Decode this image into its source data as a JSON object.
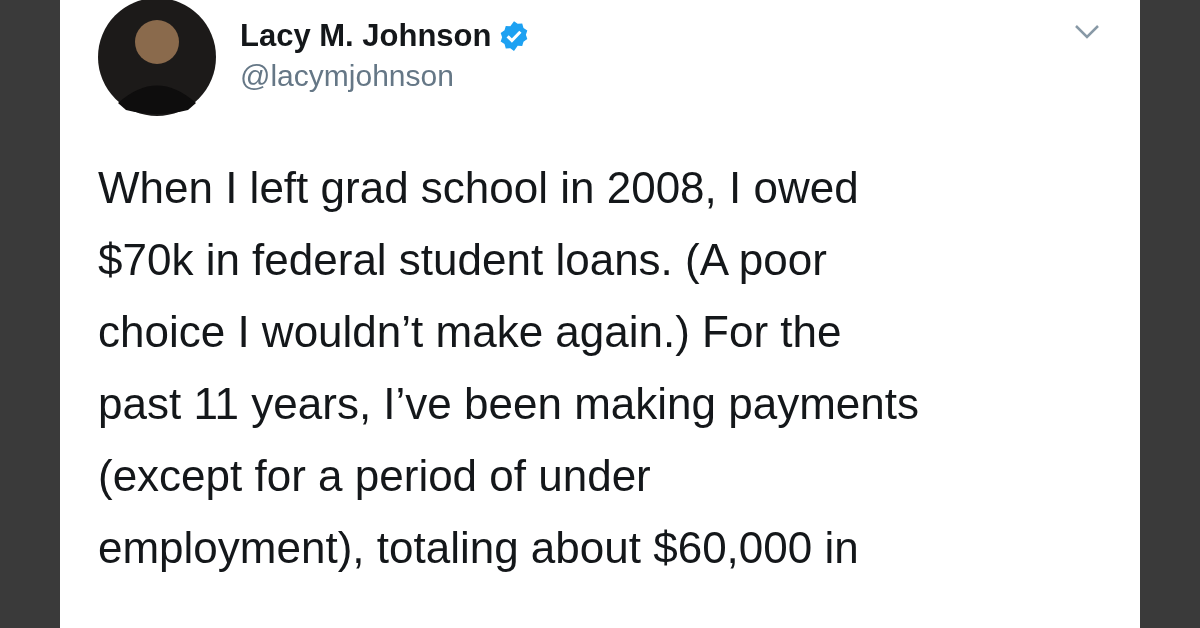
{
  "tweet": {
    "name": "Lacy M. Johnson",
    "verified": true,
    "handle": "@lacymjohnson",
    "lines": [
      "When I left grad school in 2008, I owed",
      "$70k in federal student loans. (A poor",
      "choice I wouldn’t make again.) For the",
      "past 11 years, I’ve been making payments",
      "(except for a period of under",
      "employment), totaling about $60,000 in"
    ]
  }
}
